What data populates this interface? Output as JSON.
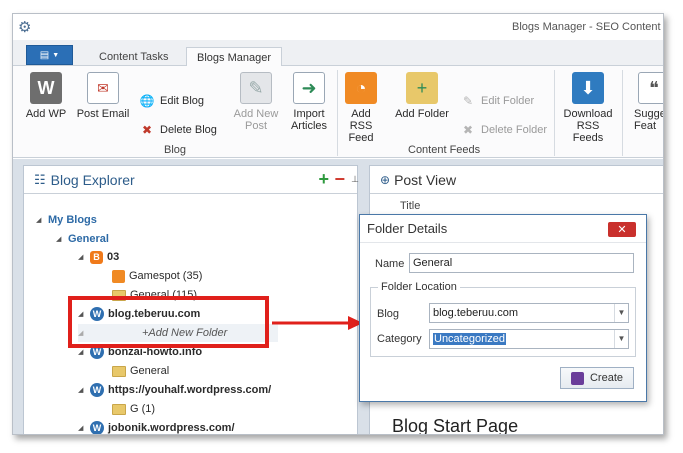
{
  "window": {
    "title": "Blogs Manager - SEO Content M"
  },
  "tabs": {
    "file_label": "▤",
    "items": [
      {
        "label": "Content Tasks"
      },
      {
        "label": "Blogs Manager"
      }
    ]
  },
  "ribbon": {
    "blog_group": {
      "label": "Blog",
      "add_wp": "Add WP",
      "post_email": "Post Email",
      "edit_blog": "Edit Blog",
      "delete_blog": "Delete Blog",
      "add_new_post": [
        "Add New",
        "Post"
      ],
      "import_articles": [
        "Import",
        "Articles"
      ]
    },
    "feeds_group": {
      "label": "Content Feeds",
      "add_rss_feed": [
        "Add RSS",
        "Feed"
      ],
      "add_folder": "Add Folder",
      "edit_folder": "Edit Folder",
      "delete_folder": "Delete Folder",
      "download_rss": [
        "Download",
        "RSS Feeds"
      ],
      "suggest": [
        "Sugge",
        "Feat"
      ]
    }
  },
  "explorer": {
    "title": "Blog Explorer",
    "add_symbol": "+",
    "remove_symbol": "−",
    "tree": {
      "my_blogs": "My Blogs",
      "general": "General",
      "blog_03": "03",
      "gamespot": "Gamespot (35)",
      "general_115": "General (115)",
      "blog_teberuu": "blog.teberuu.com",
      "add_new_folder": "+Add New Folder",
      "bonzai": "bonzai-howto.info",
      "general_child": "General",
      "youhalf": "https://youhalf.wordpress.com/",
      "g1": "G (1)",
      "jobonik": "jobonik.wordpress.com/"
    }
  },
  "postview": {
    "title": "Post View",
    "column_title": "Title",
    "start_page": "Blog Start Page"
  },
  "dialog": {
    "title": "Folder Details",
    "close_symbol": "✕",
    "name_label": "Name",
    "name_value": "General",
    "location_legend": "Folder Location",
    "blog_label": "Blog",
    "blog_value": "blog.teberuu.com",
    "category_label": "Category",
    "category_value": "Uncategorized",
    "create_label": "Create"
  },
  "colors": {
    "accent": "#2b6fb6",
    "highlight_box": "#e0201b",
    "tree_header": "#2d6aa6"
  }
}
